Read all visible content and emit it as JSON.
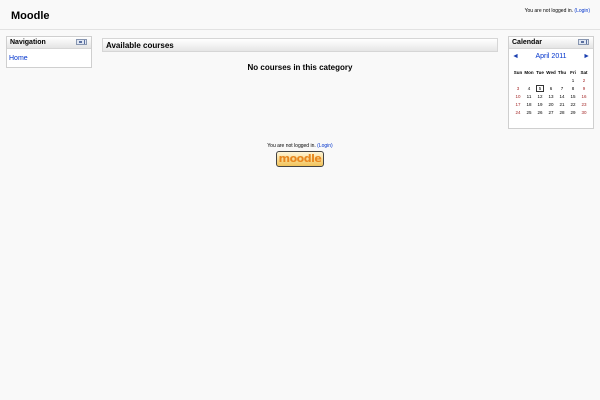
{
  "header": {
    "site_title": "Moodle",
    "login_text": "You are not logged in.",
    "login_link": "(Login)"
  },
  "navigation": {
    "title": "Navigation",
    "home_link": "Home"
  },
  "main": {
    "section_title": "Available courses",
    "empty_message": "No courses in this category"
  },
  "calendar": {
    "title": "Calendar",
    "month_label": "April 2011",
    "prev_arrow": "◄",
    "next_arrow": "►",
    "weekdays": [
      "Sun",
      "Mon",
      "Tue",
      "Wed",
      "Thu",
      "Fri",
      "Sat"
    ],
    "weeks": [
      [
        "",
        "",
        "",
        "",
        "",
        "1",
        "2"
      ],
      [
        "3",
        "4",
        "5",
        "6",
        "7",
        "8",
        "9"
      ],
      [
        "10",
        "11",
        "12",
        "13",
        "14",
        "15",
        "16"
      ],
      [
        "17",
        "18",
        "19",
        "20",
        "21",
        "22",
        "23"
      ],
      [
        "24",
        "25",
        "26",
        "27",
        "28",
        "29",
        "30"
      ]
    ],
    "today": "5"
  },
  "footer": {
    "login_text": "You are not logged in.",
    "login_link": "(Login)",
    "logo_text": "moodle"
  }
}
